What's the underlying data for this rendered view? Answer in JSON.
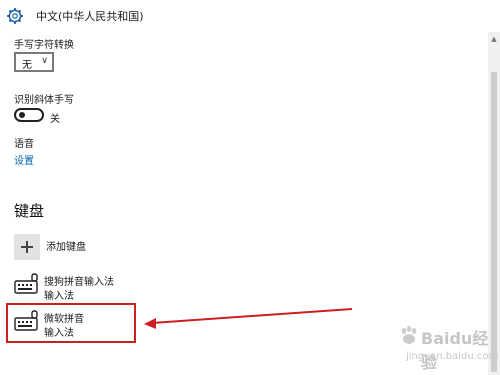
{
  "window": {
    "title": "中文(中华人民共和国)"
  },
  "handwriting": {
    "char_convert_label": "手写字符转换",
    "char_convert_value": "无",
    "cursive_label": "识别斜体手写",
    "cursive_state": "关"
  },
  "speech": {
    "label": "语音",
    "settings_link": "设置"
  },
  "keyboard": {
    "section_title": "键盘",
    "add_label": "添加键盘",
    "items": [
      {
        "name": "搜狗拼音输入法",
        "type": "输入法"
      },
      {
        "name": "微软拼音",
        "type": "输入法"
      }
    ]
  },
  "watermark": {
    "text": "Baidu经验",
    "sub": "jingyan.baidu.com"
  },
  "colors": {
    "accent": "#0066b4",
    "highlight": "#cc1f1f"
  }
}
